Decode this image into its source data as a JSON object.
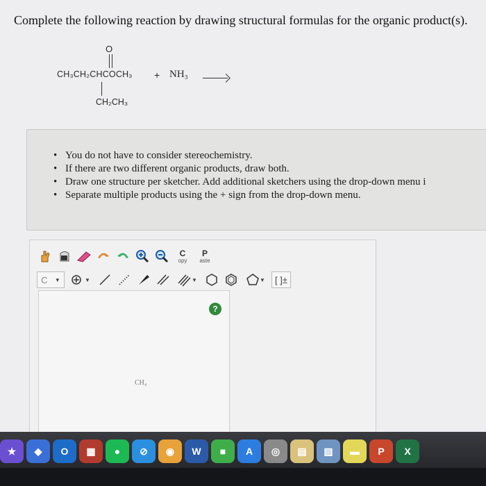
{
  "question": {
    "text": "Complete the following reaction by drawing structural formulas for the organic product(s)."
  },
  "reaction": {
    "reactant_main": "CH₃CH₂CHCOCH₃",
    "carbonyl_o": "O",
    "substituent": "CH₂CH₃",
    "plus": "+",
    "reagent": "NH₃"
  },
  "notes": {
    "items": [
      "You do not have to consider stereochemistry.",
      "If there are two different organic products, draw both.",
      "Draw one structure per sketcher. Add additional sketchers using the drop-down menu i",
      "Separate multiple products using the + sign from the drop-down menu."
    ]
  },
  "sketcher": {
    "copy_letter": "C",
    "copy_rest": "opy",
    "paste_letter": "P",
    "paste_rest": "aste",
    "element_select": "C",
    "bracket_tool": "[ ]±",
    "help_label": "?",
    "canvas_atom": "CH₄"
  },
  "dock": {
    "apps": [
      {
        "name": "imovie-star",
        "label": "★",
        "color": "#6b4fd1"
      },
      {
        "name": "launchpad",
        "label": "◆",
        "color": "#3b6fd8"
      },
      {
        "name": "outlook",
        "label": "O",
        "color": "#1d6cc7"
      },
      {
        "name": "photo-booth",
        "label": "▦",
        "color": "#b23b2f"
      },
      {
        "name": "spotify",
        "label": "●",
        "color": "#1db954"
      },
      {
        "name": "safari",
        "label": "⊘",
        "color": "#2b8fe0"
      },
      {
        "name": "chrome",
        "label": "◉",
        "color": "#e8a23a"
      },
      {
        "name": "word",
        "label": "W",
        "color": "#2b5ba8"
      },
      {
        "name": "facetime",
        "label": "■",
        "color": "#3fae4a"
      },
      {
        "name": "app-store",
        "label": "A",
        "color": "#2d7de0"
      },
      {
        "name": "screen-share",
        "label": "◎",
        "color": "#8a8a8a"
      },
      {
        "name": "notes",
        "label": "▤",
        "color": "#d9c27b"
      },
      {
        "name": "preview",
        "label": "▨",
        "color": "#6f94c2"
      },
      {
        "name": "stickies",
        "label": "▬",
        "color": "#e3d75a"
      },
      {
        "name": "powerpoint",
        "label": "P",
        "color": "#c8472c"
      },
      {
        "name": "excel",
        "label": "X",
        "color": "#217346"
      }
    ]
  }
}
